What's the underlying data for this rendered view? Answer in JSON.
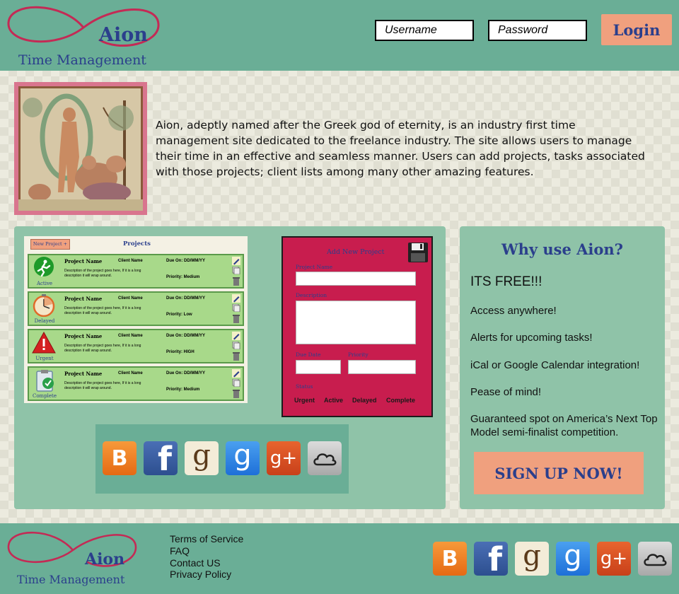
{
  "header": {
    "brand": "Aion",
    "tagline": "Time Management",
    "username_placeholder": "Username",
    "password_placeholder": "Password",
    "login_label": "Login"
  },
  "intro": {
    "text": "Aion, adeptly named after the Greek god of eternity, is an industry first time management site dedicated to the freelance industry. The site allows users to manage their time in an effective and seamless manner. Users can add projects, tasks associated with those projects; client lists among many other amazing features."
  },
  "projects_preview": {
    "new_button": "New Project +",
    "title": "Projects",
    "rows": [
      {
        "status": "Active",
        "name": "Project Name",
        "client": "Client Name",
        "due": "Due On: DD/MM/YY",
        "desc": "Description of the project goes here, If it is a long description it will wrap around.",
        "priority": "Priority: Medium"
      },
      {
        "status": "Delayed",
        "name": "Project Name",
        "client": "Client Name",
        "due": "Due On: DD/MM/YY",
        "desc": "Description of the project goes here, If it is a long description it will wrap around.",
        "priority": "Priority: Low"
      },
      {
        "status": "Urgent",
        "name": "Project Name",
        "client": "Client Name",
        "due": "Due On: DD/MM/YY",
        "desc": "Description of the project goes here, If it is a long description it will wrap around.",
        "priority": "Priority: HIGH"
      },
      {
        "status": "Complete",
        "name": "Project Name",
        "client": "Client Name",
        "due": "Due On: DD/MM/YY",
        "desc": "Description of the project goes here, If it is a long description it will wrap around.",
        "priority": "Priority: Medium"
      }
    ]
  },
  "add_project": {
    "title": "Add New Project",
    "name_label": "Project Name",
    "description_label": "Description",
    "due_label": "Due Date",
    "priority_label": "Priority",
    "status_label": "Status",
    "statuses": [
      "Urgent",
      "Active",
      "Delayed",
      "Complete"
    ]
  },
  "social_icons": [
    "blogger-icon",
    "facebook-icon",
    "goodreads-icon",
    "google-icon",
    "google-plus-icon",
    "icloud-icon"
  ],
  "social_glyphs": {
    "blogger": "B",
    "facebook": "f",
    "goodreads": "g",
    "google": "g",
    "googleplus": "g+"
  },
  "why": {
    "title": "Why use Aion?",
    "features": [
      "ITS FREE!!!",
      "Access anywhere!",
      "Alerts for upcoming tasks!",
      "iCal or Google Calendar integration!",
      "Pease of mind!",
      "Guaranteed spot on America’s Next Top Model semi-finalist competition."
    ],
    "signup_label": "SIGN UP NOW!"
  },
  "footer": {
    "brand": "Aion",
    "tagline": "Time Management",
    "links": [
      "Terms of Service",
      "FAQ",
      "Contact US",
      "Privacy Policy"
    ]
  },
  "colors": {
    "header_bg": "#6aae96",
    "panel_bg": "#8fc3a8",
    "accent_button": "#f0a07e",
    "brand_text": "#2b3f8c",
    "logo_loop": "#c42a55",
    "form_bg": "#c81d4e"
  }
}
